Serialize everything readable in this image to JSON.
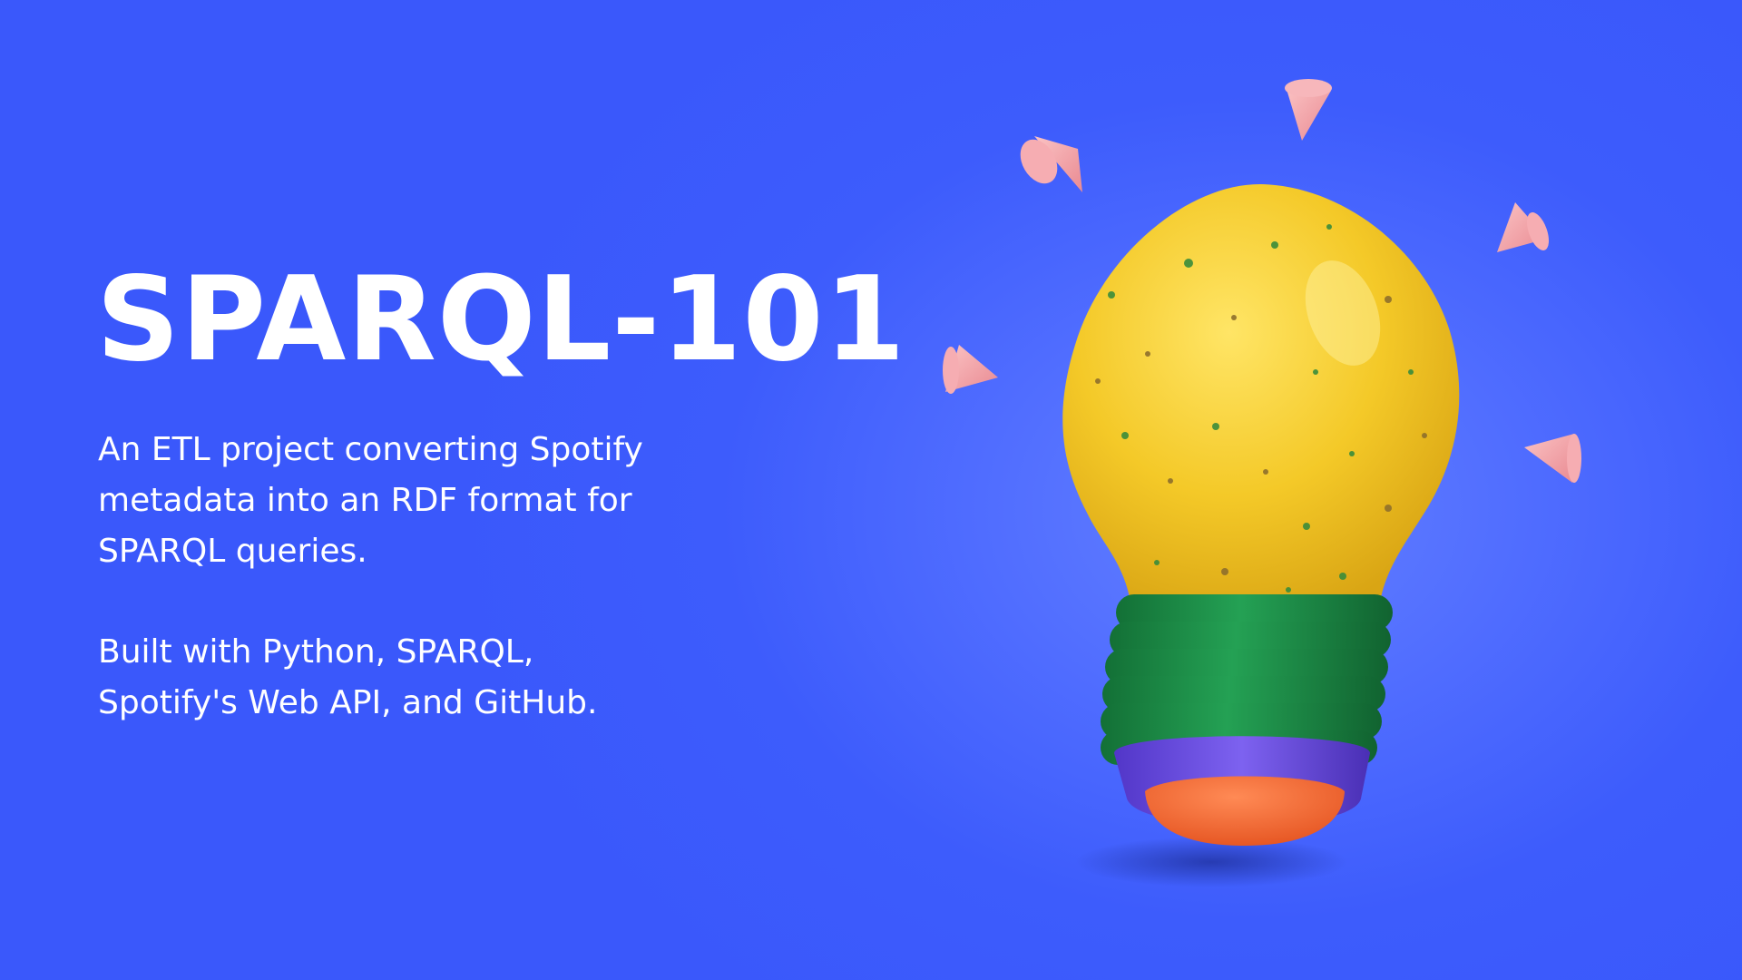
{
  "title": "SPARQL-101",
  "description": {
    "lines": [
      "An ETL project converting Spotify",
      "metadata into an RDF format for",
      "SPARQL queries."
    ]
  },
  "built_with": {
    "lines": [
      "Built with Python, SPARQL,",
      "Spotify's Web API, and GitHub."
    ]
  },
  "illustration": {
    "icon": "lightbulb-icon",
    "colors": {
      "background": "#3a58fb",
      "bulb": "#f4c928",
      "base_rings": "#1f8a45",
      "collar": "#6a4fe0",
      "tip": "#f2612c",
      "cones": "#f2a1a6"
    }
  }
}
